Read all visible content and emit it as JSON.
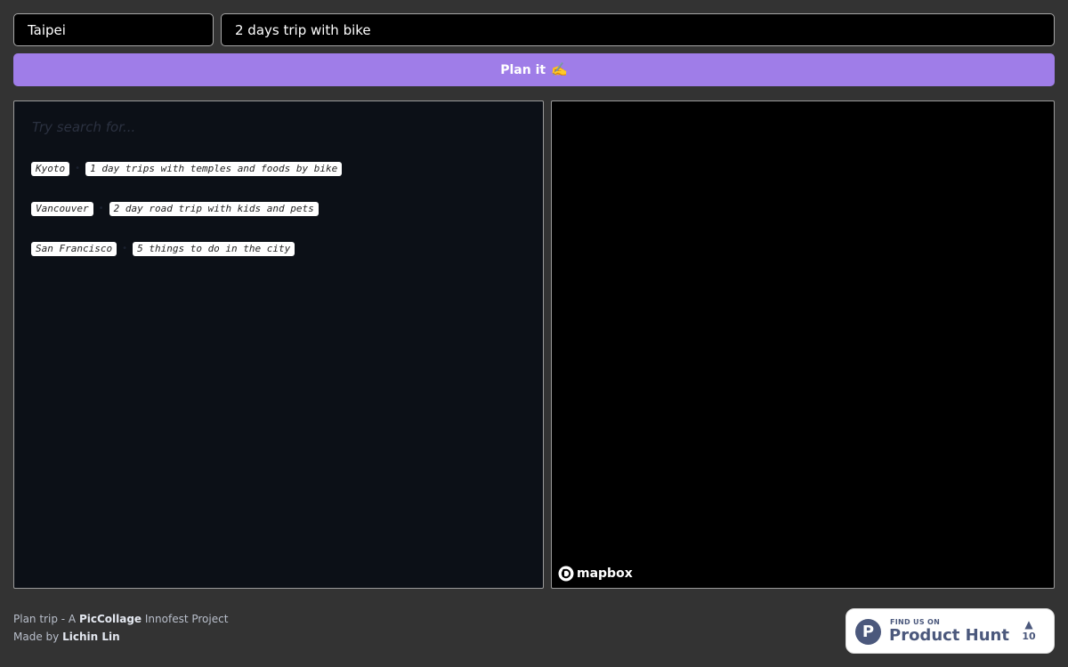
{
  "inputs": {
    "city_value": "Taipei",
    "query_value": "2 days trip with bike"
  },
  "plan_button": {
    "label": "Plan it",
    "icon": "✍️"
  },
  "suggestions": {
    "heading": "Try search for...",
    "items": [
      {
        "city": "Kyoto",
        "query": "1 day trips with temples and foods by bike"
      },
      {
        "city": "Vancouver",
        "query": "2 day road trip with kids and pets"
      },
      {
        "city": "San Francisco",
        "query": "5 things to do in the city"
      }
    ]
  },
  "map": {
    "attribution": "mapbox"
  },
  "footer": {
    "line1_prefix": "Plan trip - A",
    "line1_brand": "PicCollage",
    "line1_suffix": "Innofest Project",
    "line2_prefix": "Made by",
    "line2_author": "Lichin Lin"
  },
  "product_hunt": {
    "find_us": "FIND US ON",
    "name": "Product Hunt",
    "logo_letter": "P",
    "upvote_arrow": "▲",
    "votes": "10"
  }
}
